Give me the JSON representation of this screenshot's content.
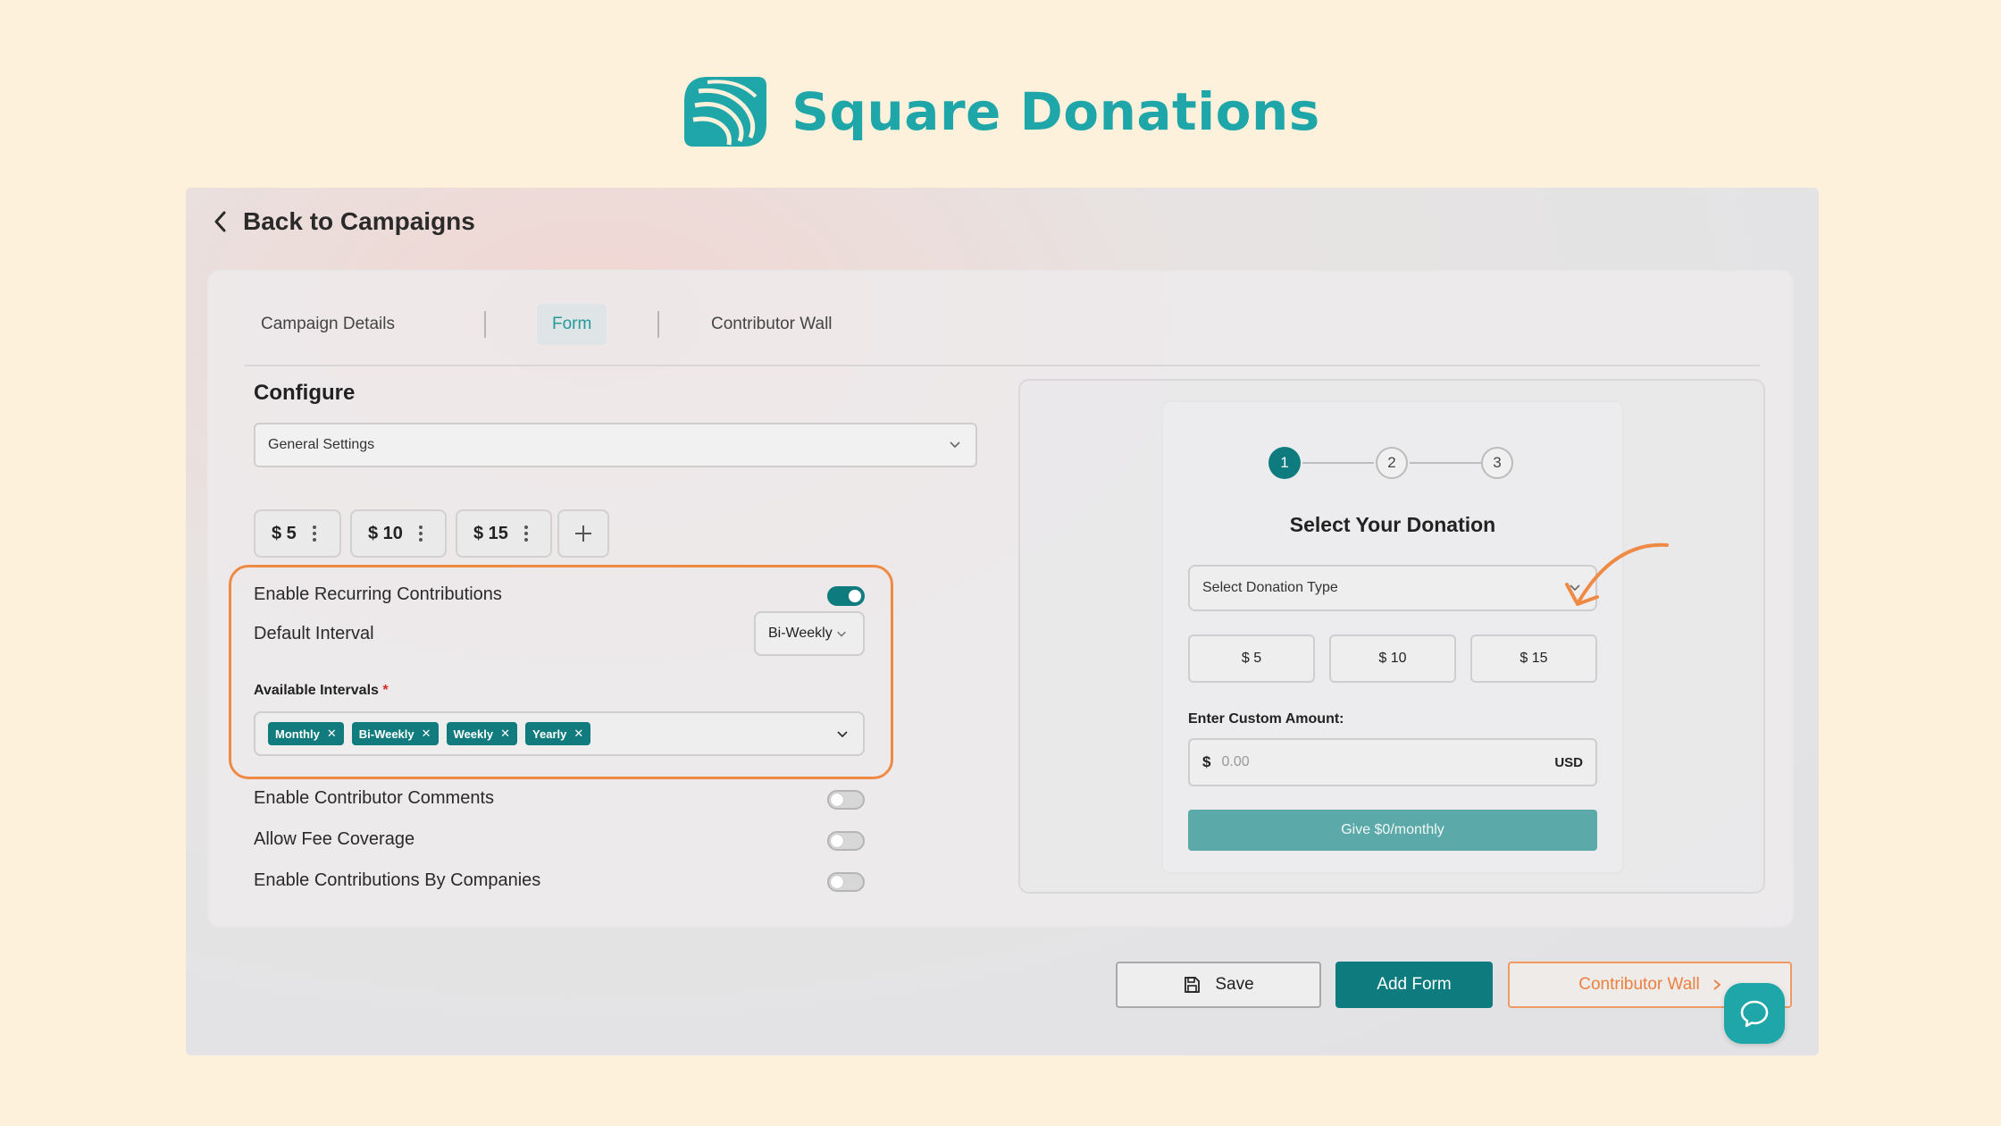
{
  "brand": {
    "name": "Square Donations",
    "color": "#1fa6a8"
  },
  "nav": {
    "back_label": "Back to Campaigns"
  },
  "tabs": [
    {
      "label": "Campaign Details",
      "active": false
    },
    {
      "label": "Form",
      "active": true
    },
    {
      "label": "Contributor Wall",
      "active": false
    }
  ],
  "configure": {
    "title": "Configure",
    "section_select": "General Settings",
    "amounts": [
      "$ 5",
      "$ 10",
      "$ 15"
    ],
    "recurring": {
      "label": "Enable Recurring Contributions",
      "enabled": true,
      "default_interval_label": "Default Interval",
      "default_interval_value": "Bi-Weekly",
      "available_label": "Available Intervals",
      "required_mark": "*",
      "intervals": [
        "Monthly",
        "Bi-Weekly",
        "Weekly",
        "Yearly"
      ]
    },
    "toggles": [
      {
        "label": "Enable Contributor Comments",
        "enabled": false
      },
      {
        "label": "Allow Fee Coverage",
        "enabled": false
      },
      {
        "label": "Enable Contributions By Companies",
        "enabled": false
      }
    ]
  },
  "preview": {
    "steps": [
      "1",
      "2",
      "3"
    ],
    "active_step": 1,
    "title": "Select Your Donation",
    "type_placeholder": "Select Donation Type",
    "amounts": [
      "$ 5",
      "$ 10",
      "$ 15"
    ],
    "custom_label": "Enter Custom Amount:",
    "currency_symbol": "$",
    "custom_placeholder": "0.00",
    "currency_code": "USD",
    "give_button": "Give $0/monthly"
  },
  "actions": {
    "save": "Save",
    "add_form": "Add Form",
    "contributor_wall": "Contributor Wall"
  },
  "colors": {
    "accent": "#0e7c7e",
    "highlight": "#ef8a45",
    "background": "#fdf1dc"
  }
}
